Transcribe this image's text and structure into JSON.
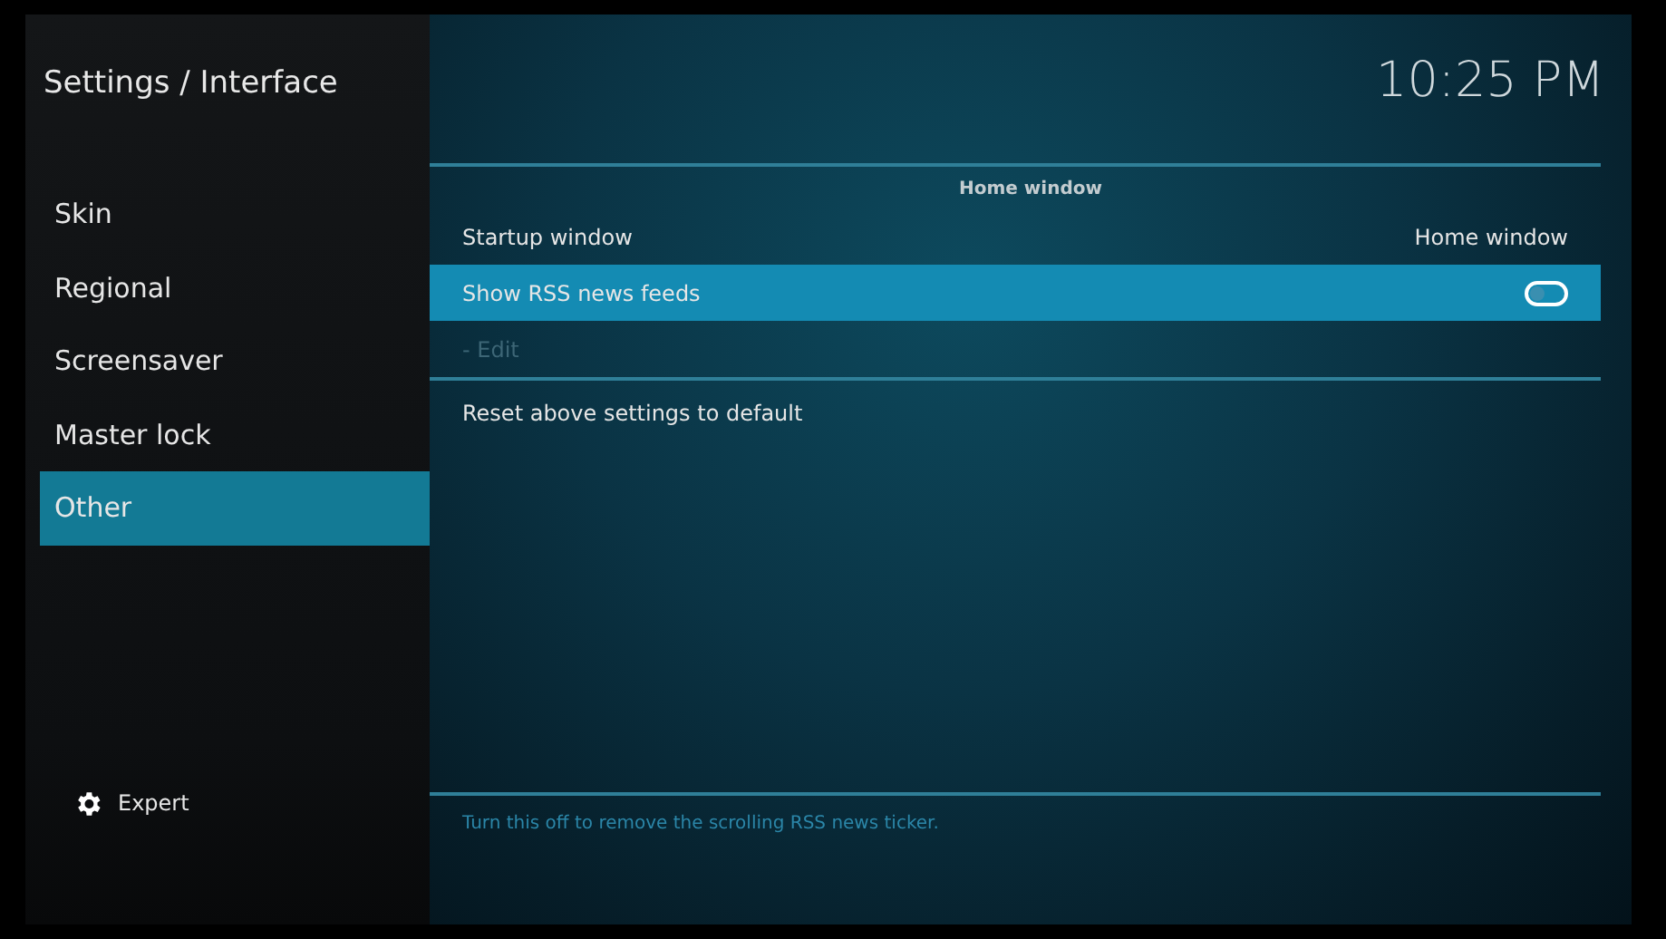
{
  "header": {
    "title": "Settings / Interface",
    "clock": "10:25 PM"
  },
  "sidebar": {
    "items": [
      {
        "label": "Skin",
        "selected": false
      },
      {
        "label": "Regional",
        "selected": false
      },
      {
        "label": "Screensaver",
        "selected": false
      },
      {
        "label": "Master lock",
        "selected": false
      },
      {
        "label": "Other",
        "selected": true
      }
    ],
    "level_button": {
      "label": "Expert"
    }
  },
  "settings": {
    "section": "Home window",
    "rows": [
      {
        "kind": "value",
        "label": "Startup window",
        "value": "Home window",
        "selected": false,
        "disabled": false
      },
      {
        "kind": "toggle",
        "label": "Show RSS news feeds",
        "on": false,
        "selected": true,
        "disabled": false
      },
      {
        "kind": "action",
        "label": "- Edit",
        "selected": false,
        "disabled": true
      }
    ],
    "reset": "Reset above settings to default"
  },
  "description": "Turn this off to remove the scrolling RSS news ticker."
}
